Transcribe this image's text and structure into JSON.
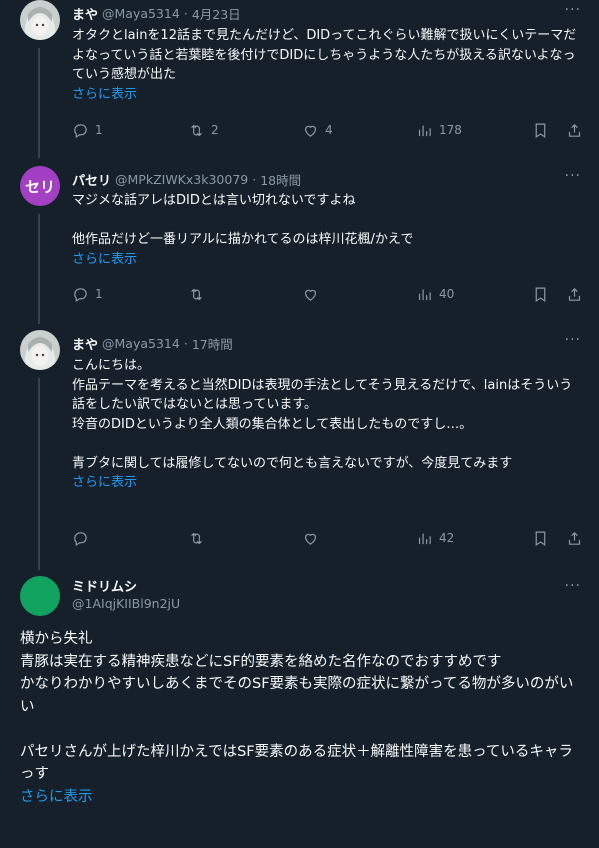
{
  "tweets": [
    {
      "name": "まや",
      "handle": "@Maya5314",
      "sep": "·",
      "time": "4月23日",
      "text": "オタクとlainを12話まで見たんだけど、DIDってこれぐらい難解で扱いにくいテーマだよなっていう話と若葉睦を後付けでDIDにしちゃうような人たちが扱える訳ないよなっていう感想が出た",
      "show_more": "さらに表示",
      "replies": "1",
      "retweets": "2",
      "likes": "4",
      "views": "178"
    },
    {
      "name": "パセリ",
      "handle": "@MPkZIWKx3k30079",
      "sep": "·",
      "time": "18時間",
      "avatar_text": "セリ",
      "text": "マジメな話アレはDIDとは言い切れないですよね\n\n他作品だけど一番リアルに描かれてるのは梓川花楓/かえで",
      "show_more": "さらに表示",
      "replies": "1",
      "retweets": "",
      "likes": "",
      "views": "40"
    },
    {
      "name": "まや",
      "handle": "@Maya5314",
      "sep": "·",
      "time": "17時間",
      "text": "こんにちは。\n作品テーマを考えると当然DIDは表現の手法としてそう見えるだけで、lainはそういう話をしたい訳ではないとは思っています。\n玲音のDIDというより全人類の集合体として表出したものですし…。\n\n青ブタに関しては履修してないので何とも言えないですが、今度見てみます",
      "show_more": "さらに表示",
      "replies": "",
      "retweets": "",
      "likes": "",
      "views": "42"
    }
  ],
  "main": {
    "name": "ミドリムシ",
    "handle": "@1AIqjKIIBl9n2jU",
    "text": "横から失礼\n青豚は実在する精神疾患などにSF的要素を絡めた名作なのでおすすめです\nかなりわかりやすいしあくまでそのSF要素も実際の症状に繋がってる物が多いのがいい\n\nパセリさんが上げた梓川かえではSF要素のある症状＋解離性障害を患っているキャラっす",
    "show_more": "さらに表示"
  },
  "icons": [
    "reply-icon",
    "retweet-icon",
    "like-icon",
    "views-icon",
    "bookmark-icon",
    "share-icon",
    "more-icon"
  ],
  "colors": {
    "background": "#15202b",
    "link": "#1d9bf0",
    "muted": "#8b98a5",
    "avatar_purple": "#a33fc2",
    "avatar_green": "#10a360"
  }
}
